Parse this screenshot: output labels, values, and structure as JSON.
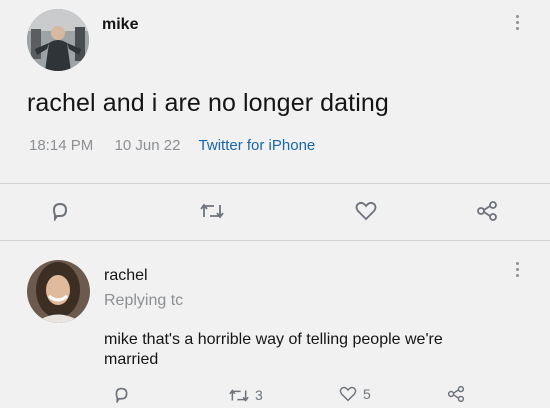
{
  "tweet": {
    "author": "mike",
    "text": "rachel and i are no longer dating",
    "time": "18:14 PM",
    "date": "10 Jun 22",
    "source": "Twitter for iPhone",
    "source_color": "#1a66a8",
    "actions": [
      "reply-icon",
      "retweet-icon",
      "like-icon",
      "share-icon"
    ]
  },
  "reply": {
    "author": "rachel",
    "replying_to": "Replying tc",
    "text_line1": "mike that's a horrible way of telling people we're",
    "text_line2": "married",
    "retweet_count": "3",
    "like_count": "5",
    "actions": [
      "reply-icon",
      "retweet-icon",
      "like-icon",
      "share-icon"
    ]
  }
}
